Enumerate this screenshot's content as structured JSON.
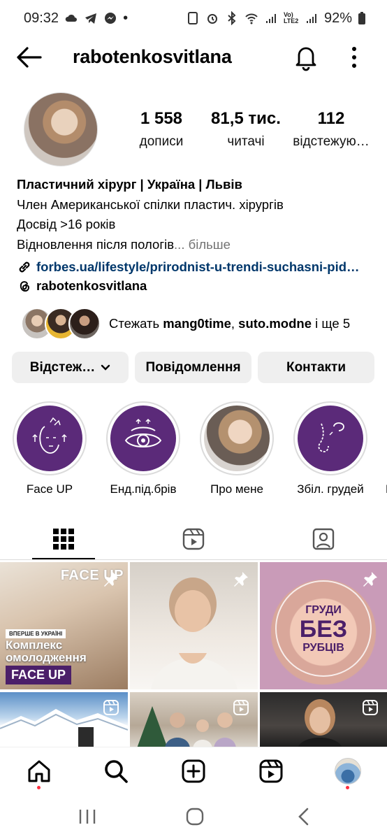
{
  "status_bar": {
    "time": "09:32",
    "dot": "•",
    "battery_percent": "92%",
    "net_label": "Vo) LTE2"
  },
  "header": {
    "username": "rabotenkosvitlana"
  },
  "profile": {
    "stats": [
      {
        "value": "1 558",
        "label": "дописи"
      },
      {
        "value": "81,5 тис.",
        "label": "читачі"
      },
      {
        "value": "112",
        "label": "відстежую…"
      }
    ],
    "bio": {
      "name": "Пластичний хірург | Україна | Львів",
      "line1": "Член Американської спілки пластич. хірургів",
      "line2": "Досвід >16 років",
      "line3": "Відновлення після пологів",
      "more": "... більше",
      "link": "forbes.ua/lifestyle/prirodnist-u-trendi-suchasni-pid…"
    },
    "threads_handle": "rabotenkosvitlana",
    "followed_by": {
      "prefix": "Стежать ",
      "name1": "mang0time",
      "sep": ", ",
      "name2": "suto.modne",
      "suffix": " і ще 5"
    }
  },
  "actions": {
    "follow": "Відстеж…",
    "message": "Повідомлення",
    "contacts": "Контакти"
  },
  "highlights": [
    {
      "label": "Face UP"
    },
    {
      "label": "Енд.під.брів"
    },
    {
      "label": "Про мене"
    },
    {
      "label": "Збіл. грудей"
    },
    {
      "label": "Пі"
    }
  ],
  "grid": {
    "tile1": {
      "face": "FACE UP",
      "badge": "ВПЕРШЕ В УКРАЇНІ",
      "title_l1": "Комплекс",
      "title_l2": "омолодження",
      "box": "FACE UP"
    },
    "tile3": {
      "l1": "ГРУДИ",
      "l2": "БЕЗ",
      "l3": "РУБЦІВ"
    }
  },
  "colors": {
    "accent_purple": "#5b2a79",
    "link_blue": "#00376b",
    "notification_red": "#ff3040"
  }
}
